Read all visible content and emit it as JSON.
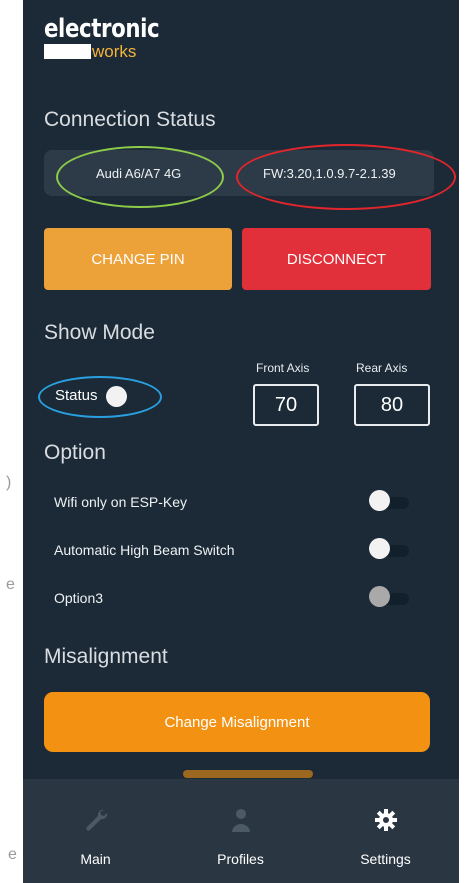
{
  "background_fragments": [
    ")",
    "e",
    "e"
  ],
  "logo": {
    "line1": "electronic",
    "line2": "works"
  },
  "connection": {
    "title": "Connection Status",
    "car": "Audi A6/A7 4G",
    "firmware": "FW:3.20,1.0.9.7-2.1.39"
  },
  "buttons": {
    "change_pin": "CHANGE PIN",
    "disconnect": "DISCONNECT",
    "change_misalignment": "Change Misalignment"
  },
  "show_mode": {
    "title": "Show Mode",
    "status_label": "Status",
    "status_on": false,
    "front_axis_label": "Front Axis",
    "front_axis_value": "70",
    "rear_axis_label": "Rear Axis",
    "rear_axis_value": "80"
  },
  "options": {
    "title": "Option",
    "items": [
      {
        "label": "Wifi only on ESP-Key",
        "on": false
      },
      {
        "label": "Automatic High Beam Switch",
        "on": false
      },
      {
        "label": "Option3",
        "on": false,
        "disabled": true
      }
    ]
  },
  "misalignment": {
    "title": "Misalignment"
  },
  "nav": {
    "items": [
      {
        "label": "Main",
        "icon": "wrench-icon",
        "active": false
      },
      {
        "label": "Profiles",
        "icon": "user-icon",
        "active": false
      },
      {
        "label": "Settings",
        "icon": "gear-icon",
        "active": true
      }
    ]
  },
  "annotation_colors": {
    "green": "#8ecb4a",
    "red": "#e0262c",
    "blue": "#2a9fe0"
  },
  "colors": {
    "background": "#1b2a36",
    "orange": "#eda139",
    "red": "#e2303a",
    "misalignment_orange": "#f39212",
    "navbar": "#2a3641"
  }
}
